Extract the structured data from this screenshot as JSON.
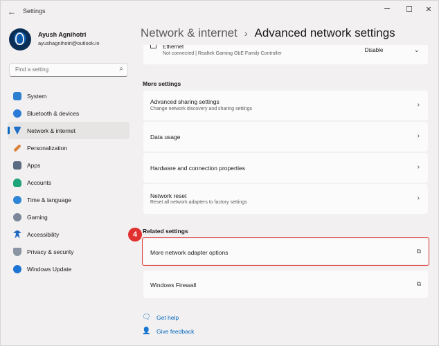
{
  "window": {
    "app_title": "Settings",
    "back_glyph": "←",
    "minimize_glyph": "─",
    "maximize_glyph": "☐",
    "close_glyph": "✕"
  },
  "profile": {
    "name": "Ayush Agnihotri",
    "email": "ayushagnihotri@outlook.in"
  },
  "search": {
    "placeholder": "Find a setting",
    "icon": "search-icon"
  },
  "nav": {
    "items": [
      {
        "label": "System",
        "icon": "system-icon",
        "color": "#2f7fd1"
      },
      {
        "label": "Bluetooth & devices",
        "icon": "bluetooth-icon",
        "color": "#2b7ad6"
      },
      {
        "label": "Network & internet",
        "icon": "wifi-icon",
        "color": "#1f6fc9",
        "active": true
      },
      {
        "label": "Personalization",
        "icon": "brush-icon",
        "color": "#d9833a"
      },
      {
        "label": "Apps",
        "icon": "apps-icon",
        "color": "#5b6b82"
      },
      {
        "label": "Accounts",
        "icon": "accounts-icon",
        "color": "#1fa37a"
      },
      {
        "label": "Time & language",
        "icon": "globe-icon",
        "color": "#2f86d6"
      },
      {
        "label": "Gaming",
        "icon": "gaming-icon",
        "color": "#7a8799"
      },
      {
        "label": "Accessibility",
        "icon": "accessibility-icon",
        "color": "#2269c4"
      },
      {
        "label": "Privacy & security",
        "icon": "shield-icon",
        "color": "#8a94a3"
      },
      {
        "label": "Windows Update",
        "icon": "update-icon",
        "color": "#1c74d4"
      }
    ]
  },
  "breadcrumb": {
    "parent": "Network & internet",
    "separator": "›",
    "current": "Advanced network settings"
  },
  "ethernet": {
    "title": "Ethernet",
    "desc": "Not connected | Realtek Gaming GbE Family Controller",
    "button": "Disable",
    "chevron": "⌄"
  },
  "more_settings": {
    "label": "More settings",
    "items": [
      {
        "title": "Advanced sharing settings",
        "desc": "Change network discovery and sharing settings"
      },
      {
        "title": "Data usage",
        "desc": ""
      },
      {
        "title": "Hardware and connection properties",
        "desc": ""
      },
      {
        "title": "Network reset",
        "desc": "Reset all network adapters to factory settings"
      }
    ],
    "chevron": "›"
  },
  "related_settings": {
    "label": "Related settings",
    "items": [
      {
        "title": "More network adapter options"
      },
      {
        "title": "Windows Firewall"
      }
    ],
    "external_glyph": "⧉"
  },
  "step_badge": "4",
  "highlight_color": "#e03838",
  "links": [
    {
      "label": "Get help",
      "icon": "help-icon",
      "glyph": "🗨"
    },
    {
      "label": "Give feedback",
      "icon": "feedback-icon",
      "glyph": "👤"
    }
  ]
}
